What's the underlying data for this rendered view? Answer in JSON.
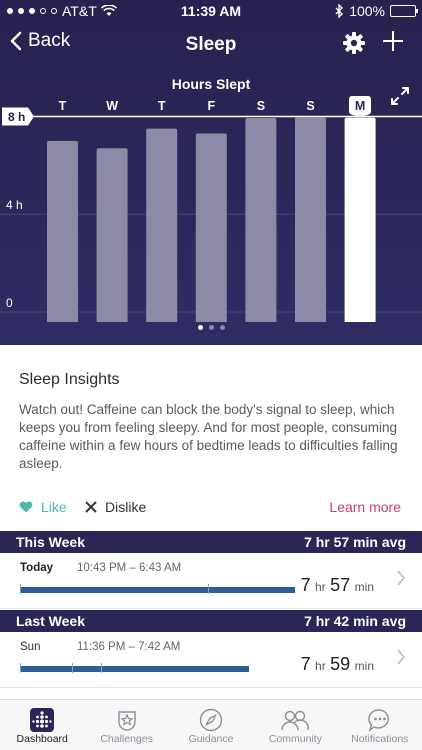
{
  "status_bar": {
    "carrier": "AT&T",
    "time": "11:39 AM",
    "battery": "100%"
  },
  "nav": {
    "back_label": "Back",
    "title": "Sleep"
  },
  "chart_data": {
    "type": "bar",
    "title": "Hours Slept",
    "categories": [
      "T",
      "W",
      "T",
      "F",
      "S",
      "S",
      "M"
    ],
    "selected_index": 6,
    "values": [
      7.0,
      6.7,
      7.5,
      7.3,
      7.93,
      7.97,
      7.95
    ],
    "ylim": [
      0,
      9
    ],
    "yticks": [
      0,
      4,
      8
    ],
    "ytick_labels": [
      "0",
      "4 h",
      "8 h"
    ],
    "goal_label": "8 h",
    "goal_value": 8,
    "bar_color": "#8d8aa8",
    "selected_color": "#ffffff"
  },
  "pager": {
    "count": 3,
    "active": 0
  },
  "insights": {
    "title": "Sleep Insights",
    "text": "Watch out! Caffeine can block the body's signal to sleep, which keeps you from feeling sleepy. And for most people, consuming caffeine within a few hours of bedtime leads to difficulties falling asleep.",
    "like": "Like",
    "dislike": "Dislike",
    "learn_more": "Learn more"
  },
  "this_week": {
    "label": "This Week",
    "avg": "7 hr 57 min avg",
    "entry": {
      "day": "Today",
      "range": "10:43 PM – 6:43 AM",
      "hours": "7",
      "hr_unit": "hr",
      "minutes": "57",
      "min_unit": "min"
    }
  },
  "last_week": {
    "label": "Last Week",
    "avg": "7 hr 42 min avg",
    "entry": {
      "day": "Sun",
      "range": "11:36 PM – 7:42 AM",
      "hours": "7",
      "hr_unit": "hr",
      "minutes": "59",
      "min_unit": "min"
    }
  },
  "tabs": [
    {
      "label": "Dashboard",
      "icon": "dashboard-icon",
      "active": true
    },
    {
      "label": "Challenges",
      "icon": "challenges-icon",
      "active": false
    },
    {
      "label": "Guidance",
      "icon": "compass-icon",
      "active": false
    },
    {
      "label": "Community",
      "icon": "community-icon",
      "active": false
    },
    {
      "label": "Notifications",
      "icon": "notifications-icon",
      "active": false
    }
  ],
  "colors": {
    "header_bg": "#2a2655",
    "accent_like": "#4fb7b1",
    "learn_more": "#c0446b",
    "sleep_bar": "#2d5d94"
  }
}
